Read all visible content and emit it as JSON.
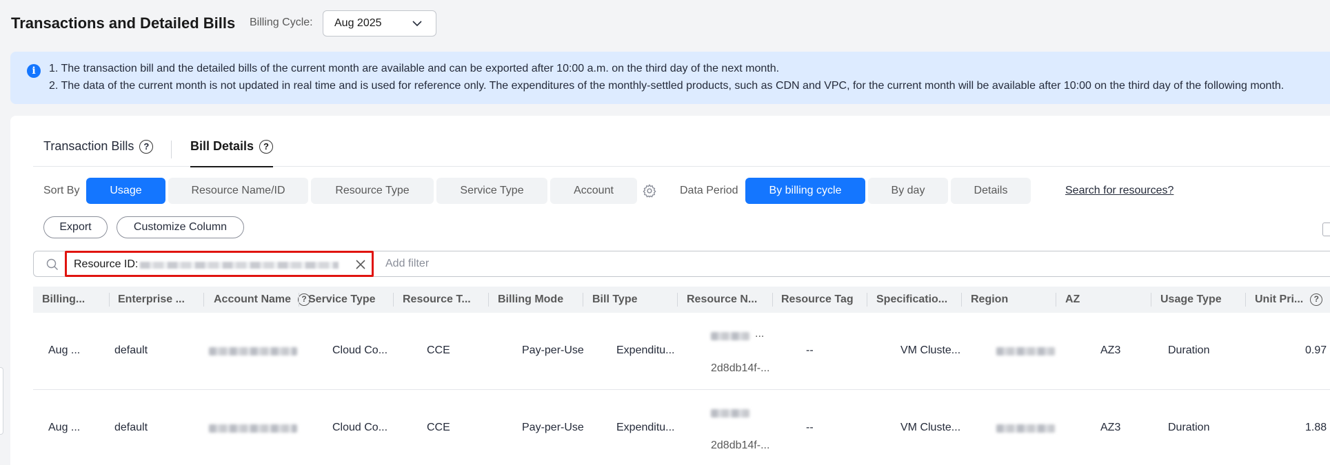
{
  "header": {
    "title": "Transactions and Detailed Bills",
    "billing_cycle_label": "Billing Cycle:",
    "billing_cycle_value": "Aug 2025"
  },
  "notice": {
    "line1": "1. The transaction bill and the detailed bills of the current month are available and can be exported after 10:00 a.m. on the third day of the next month.",
    "line2": "2. The data of the current month is not updated in real time and is used for reference only. The expenditures of the monthly-settled products, such as CDN and VPC, for the current month will be available after 10:00 on the third day of the following month."
  },
  "tabs": [
    {
      "label": "Transaction Bills"
    },
    {
      "label": "Bill Details"
    }
  ],
  "sort": {
    "label": "Sort By",
    "options": [
      "Usage",
      "Resource Name/ID",
      "Resource Type",
      "Service Type",
      "Account"
    ],
    "active": "Usage"
  },
  "period": {
    "label": "Data Period",
    "options": [
      "By billing cycle",
      "By day",
      "Details"
    ],
    "active": "By billing cycle"
  },
  "search_link": "Search for resources?",
  "buttons": {
    "export": "Export",
    "customize": "Customize Column"
  },
  "filter": {
    "chip_key": "Resource ID:",
    "placeholder": "Add filter"
  },
  "table": {
    "columns": [
      "Billing...",
      "Enterprise ...",
      "Account Name",
      "Service Type",
      "Resource T...",
      "Billing Mode",
      "Bill Type",
      "Resource N...",
      "Resource Tag",
      "Specificatio...",
      "Region",
      "AZ",
      "Usage Type",
      "Unit Pri..."
    ],
    "rows": [
      {
        "billing": "Aug ...",
        "enterprise": "default",
        "service_type": "Cloud Co...",
        "resource_type": "CCE",
        "billing_mode": "Pay-per-Use",
        "bill_type": "Expenditu...",
        "resource_name_suffix": "...",
        "resource_id": "2d8db14f-...",
        "resource_tag": "--",
        "specification": "VM Cluste...",
        "az": "AZ3",
        "usage_type": "Duration",
        "unit_price": "0.97"
      },
      {
        "billing": "Aug ...",
        "enterprise": "default",
        "service_type": "Cloud Co...",
        "resource_type": "CCE",
        "billing_mode": "Pay-per-Use",
        "bill_type": "Expenditu...",
        "resource_name_suffix": "",
        "resource_id": "2d8db14f-...",
        "resource_tag": "--",
        "specification": "VM Cluste...",
        "az": "AZ3",
        "usage_type": "Duration",
        "unit_price": "1.88"
      }
    ]
  },
  "colors": {
    "primary": "#1476ff",
    "notice_bg": "#ddebff",
    "highlight_border": "#e0140f",
    "page_bg": "#f3f4f6"
  },
  "icons": [
    "info-icon",
    "help-icon",
    "chevron-down-icon",
    "gear-icon",
    "search-icon",
    "close-icon"
  ]
}
